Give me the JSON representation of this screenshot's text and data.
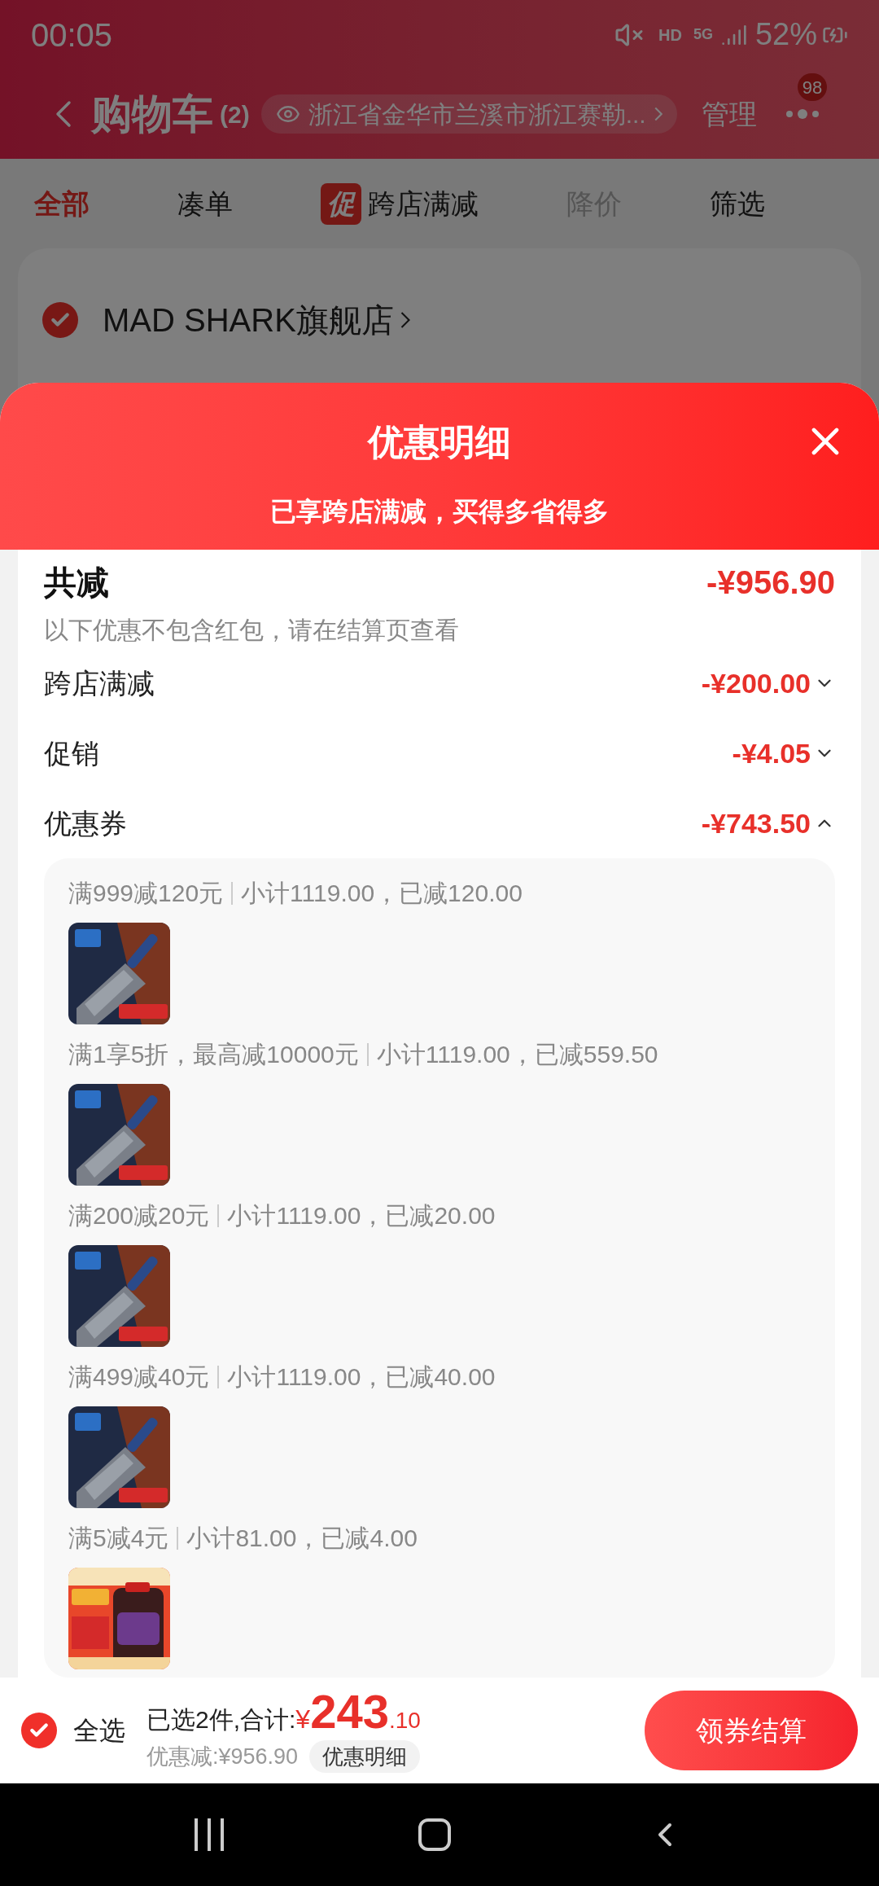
{
  "status_bar": {
    "time": "00:05",
    "network": "HD",
    "signal_type": "5G",
    "battery": "52%"
  },
  "header": {
    "title": "购物车",
    "count": "(2)",
    "location": "浙江省金华市兰溪市浙江赛勒...",
    "manage": "管理",
    "badge": "98"
  },
  "tabs": [
    {
      "label": "全部",
      "selected": true,
      "disabled": false
    },
    {
      "label": "凑单",
      "selected": false,
      "disabled": false
    },
    {
      "label": "跨店满减",
      "selected": false,
      "disabled": false,
      "badge": "促"
    },
    {
      "label": "降价",
      "selected": false,
      "disabled": true
    },
    {
      "label": "筛选",
      "selected": false,
      "disabled": false
    }
  ],
  "store": {
    "name": "MAD SHARK旗舰店",
    "checked": true
  },
  "sheet": {
    "title": "优惠明细",
    "subtitle": "已享跨店满减，买得多省得多",
    "total_label": "共减",
    "total": "-¥956.90",
    "note": "以下优惠不包含红包，请在结算页查看",
    "breakdown": [
      {
        "label": "跨店满减",
        "amount": "-¥200.00",
        "expanded": false
      },
      {
        "label": "促销",
        "amount": "-¥4.05",
        "expanded": false
      },
      {
        "label": "优惠券",
        "amount": "-¥743.50",
        "expanded": true
      }
    ],
    "coupons": [
      {
        "rule": "满999减120元",
        "detail": "小计1119.00，已减120.00"
      },
      {
        "rule": "满1享5折，最高减10000元",
        "detail": "小计1119.00，已减559.50"
      },
      {
        "rule": "满200减20元",
        "detail": "小计1119.00，已减20.00"
      },
      {
        "rule": "满499减40元",
        "detail": "小计1119.00，已减40.00"
      },
      {
        "rule": "满5减4元",
        "detail": "小计81.00，已减4.00"
      }
    ]
  },
  "footer": {
    "select_all": {
      "label": "全选",
      "checked": true
    },
    "summary": "已选2件,合计:",
    "currency": "¥",
    "price_int": "243",
    "price_dec": ".10",
    "saved": "优惠减:¥956.90",
    "details_button": "优惠明细",
    "checkout": "领券结算"
  }
}
